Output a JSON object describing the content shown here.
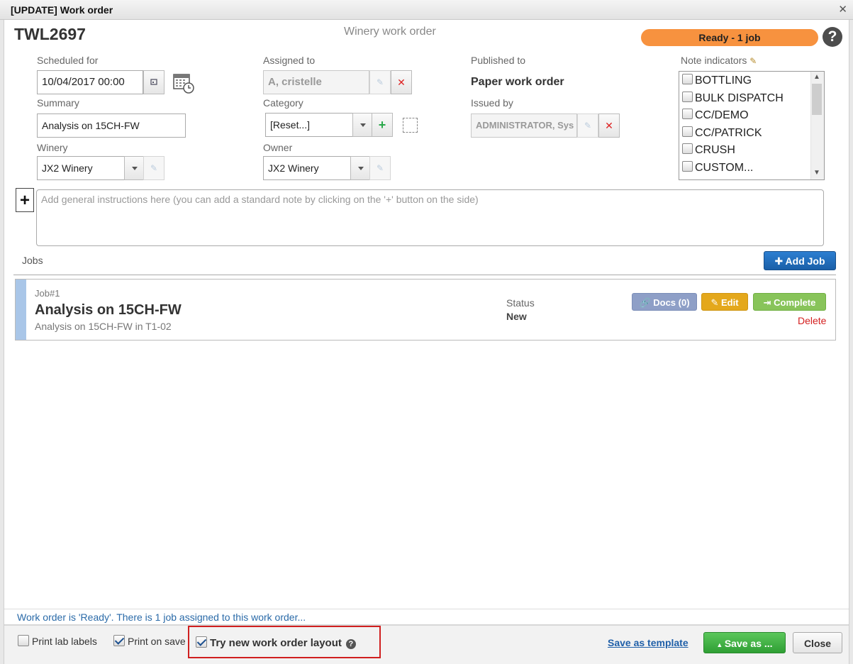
{
  "window": {
    "title": "[UPDATE] Work order",
    "close_icon": "close-icon"
  },
  "header": {
    "wo_number": "TWL2697",
    "wo_type": "Winery work order",
    "status_pill": "Ready - 1 job",
    "status_color": "#f7923f",
    "help_glyph": "?"
  },
  "form": {
    "scheduled_label": "Scheduled for",
    "scheduled_value": "10/04/2017 00:00",
    "summary_label": "Summary",
    "summary_value": "Analysis on 15CH-FW",
    "winery_label": "Winery",
    "winery_value": "JX2 Winery",
    "assigned_label": "Assigned to",
    "assigned_value": "A, cristelle",
    "category_label": "Category",
    "category_value": "[Reset...]",
    "owner_label": "Owner",
    "owner_value": "JX2 Winery",
    "published_label": "Published to",
    "published_value": "Paper work order",
    "issued_label": "Issued by",
    "issued_value": "ADMINISTRATOR, Sys",
    "note_indicators_label": "Note indicators",
    "note_indicators": [
      "BOTTLING",
      "BULK DISPATCH",
      "CC/DEMO",
      "CC/PATRICK",
      "CRUSH",
      "CUSTOM..."
    ]
  },
  "instructions": {
    "placeholder": "Add general instructions here (you can add a standard note by clicking on the '+' button on the side)",
    "add_note_glyph": "+"
  },
  "jobs": {
    "label": "Jobs",
    "add_job_label": "Add Job",
    "items": [
      {
        "number": "Job#1",
        "title": "Analysis on 15CH-FW",
        "subtitle": "Analysis on 15CH-FW in T1-02",
        "status_label": "Status",
        "status_value": "New",
        "docs_label": "Docs (0)",
        "edit_label": "Edit",
        "complete_label": "Complete",
        "delete_label": "Delete"
      }
    ]
  },
  "status_message": "Work order is 'Ready'. There is 1 job assigned to this work order...",
  "footer": {
    "print_lab_labels": "Print lab labels",
    "print_on_save": "Print on save",
    "try_new_layout": "Try new work order layout",
    "save_as_template": "Save as template",
    "save_as": "Save as ...",
    "close": "Close",
    "highlight_color": "#d01f1f"
  }
}
